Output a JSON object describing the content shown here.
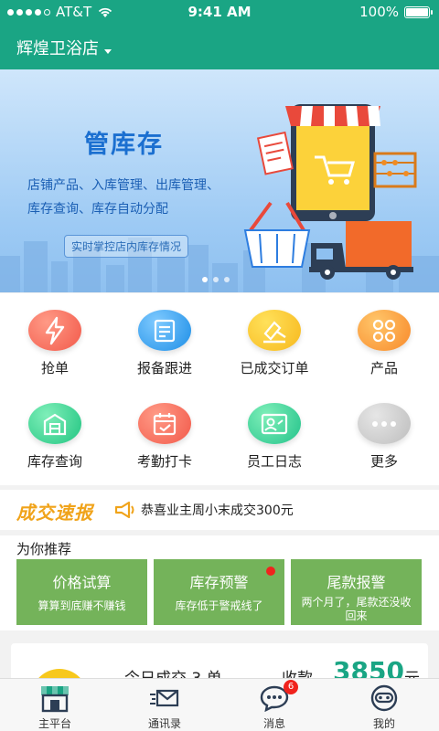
{
  "status_bar": {
    "carrier": "AT&T",
    "time": "9:41 AM",
    "battery_percent": "100%"
  },
  "header": {
    "store_name": "辉煌卫浴店"
  },
  "banner": {
    "title": "管库存",
    "line1": "店铺产品、入库管理、出库管理、",
    "line2": "库存查询、库存自动分配",
    "tagline": "实时掌控店内库存情况",
    "slide_count": 3,
    "active_slide": 1
  },
  "grid": {
    "items": [
      {
        "label": "抢单",
        "icon": "lightning-icon",
        "color": "#f2594a"
      },
      {
        "label": "报备跟进",
        "icon": "report-icon",
        "color": "#1d8ee6"
      },
      {
        "label": "已成交订单",
        "icon": "gavel-icon",
        "color": "#f7b81d"
      },
      {
        "label": "产品",
        "icon": "clover-icon",
        "color": "#f8892a"
      },
      {
        "label": "库存查询",
        "icon": "warehouse-icon",
        "color": "#21c481"
      },
      {
        "label": "考勤打卡",
        "icon": "calendar-check-icon",
        "color": "#f2594a"
      },
      {
        "label": "员工日志",
        "icon": "id-card-icon",
        "color": "#22c28a"
      },
      {
        "label": "更多",
        "icon": "more-icon",
        "color": "#bdbdbd"
      }
    ]
  },
  "deals": {
    "logo": "成交速报",
    "message": "恭喜业主周小末成交300元"
  },
  "recommend": {
    "heading": "为你推荐",
    "cards": [
      {
        "title": "价格试算",
        "subtitle": "算算到底赚不赚钱",
        "has_dot": false
      },
      {
        "title": "库存预警",
        "subtitle": "库存低于警戒线了",
        "has_dot": true
      },
      {
        "title": "尾款报警",
        "subtitle": "两个月了，尾款还没收回来",
        "has_dot": false
      }
    ]
  },
  "summary": {
    "today_label": "今日成交 3 单",
    "income_label": "收款",
    "amount": "3850",
    "unit": "元"
  },
  "tabbar": {
    "tabs": [
      {
        "label": "主平台",
        "icon": "storefront-icon",
        "active": true
      },
      {
        "label": "通讯录",
        "icon": "contacts-mail-icon",
        "active": false
      },
      {
        "label": "消息",
        "icon": "chat-bubble-icon",
        "badge": "6",
        "active": false
      },
      {
        "label": "我的",
        "icon": "profile-icon",
        "active": false
      }
    ]
  }
}
